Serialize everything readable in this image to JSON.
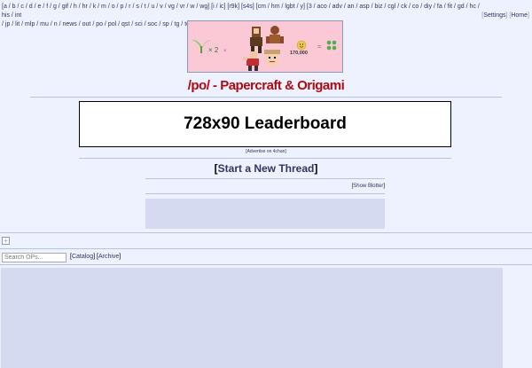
{
  "boards_line1": "[a / b / c / d / e / f / g / gif / h / hr / k / m / o / p / r / s / t / u / v / vg / vr / w / wg] [i / ic] [r9k] [s4s] [cm / hm / lgbt / y] [3 / aco / adv / an / asp / biz / cgl / ck / co / diy / fa / fit / gd / hc / his / int",
  "boards_line2": "/ jp / lit / mlp / mu / n / news / out / po / pol / qst / sci / soc / sp / tg / toy / trv / tv / vp / wsg / wsr / x] [Edit]",
  "nav_right": {
    "settings": "Settings",
    "home": "Home"
  },
  "banner": {
    "times": "× 2",
    "score": "170,000",
    "equals": "="
  },
  "board_title": "/po/ - Papercraft & Origami",
  "leaderboard_text": "728x90 Leaderboard",
  "advertise_text": "[Advertise on 4chan]",
  "new_thread_label": "Start a New Thread",
  "blotter_label": "Show Blotter",
  "toggle_symbol": "+",
  "search": {
    "placeholder": "Search OPs..."
  },
  "catalog_label": "Catalog",
  "archive_label": "Archive",
  "colors": {
    "background": "#eef2ff",
    "title": "#af0a0f",
    "link": "#34345c",
    "post_bg": "#d6daf0",
    "banner_bg": "#fbc8d6"
  }
}
